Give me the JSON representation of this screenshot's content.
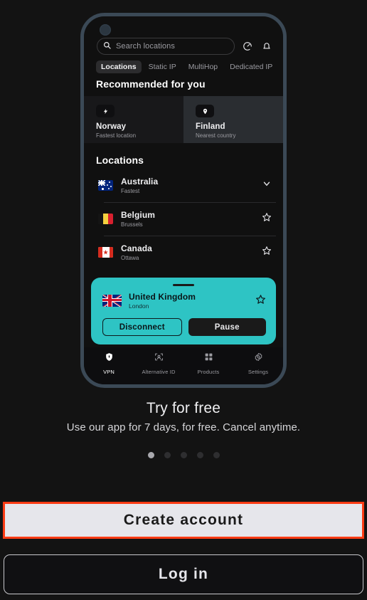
{
  "app": {
    "phone": {
      "avatar": "avatar-dot",
      "search": {
        "placeholder": "Search locations",
        "search_icon": "search-icon",
        "speed_icon": "speedometer-icon",
        "bell_icon": "bell-icon"
      },
      "tabs": [
        {
          "label": "Locations",
          "active": true
        },
        {
          "label": "Static IP",
          "active": false
        },
        {
          "label": "MultiHop",
          "active": false
        },
        {
          "label": "Dedicated IP",
          "active": false
        }
      ],
      "recommended": {
        "title": "Recommended for you",
        "cards": [
          {
            "name": "Norway",
            "sub": "Fastest location",
            "icon": "lightning-bolt-icon"
          },
          {
            "name": "Finland",
            "sub": "Nearest country",
            "icon": "map-pin-icon"
          }
        ]
      },
      "locations": {
        "title": "Locations",
        "rows": [
          {
            "name": "Australia",
            "sub": "Fastest",
            "action": "chevron-down-icon"
          },
          {
            "name": "Belgium",
            "sub": "Brussels",
            "action": "star-outline-icon"
          },
          {
            "name": "Canada",
            "sub": "Ottawa",
            "action": "star-outline-icon"
          }
        ]
      },
      "connected_sheet": {
        "country": "United Kingdom",
        "city": "London",
        "favorite_icon": "star-outline-icon",
        "disconnect_label": "Disconnect",
        "pause_label": "Pause",
        "accent_color": "#2ec4c4"
      },
      "nav": [
        {
          "label": "VPN",
          "icon": "shield-lock-icon",
          "active": true
        },
        {
          "label": "Alternative ID",
          "icon": "identity-scan-icon",
          "active": false
        },
        {
          "label": "Products",
          "icon": "grid-squares-icon",
          "active": false
        },
        {
          "label": "Settings",
          "icon": "gear-icon",
          "active": false
        }
      ]
    },
    "promo": {
      "title": "Try for free",
      "subtitle": "Use our app for 7 days, for free. Cancel anytime.",
      "dots_total": 5,
      "dots_active_index": 0
    },
    "cta": {
      "create_account": "Create account",
      "log_in": "Log in",
      "highlight_color": "#fc3b14"
    }
  }
}
